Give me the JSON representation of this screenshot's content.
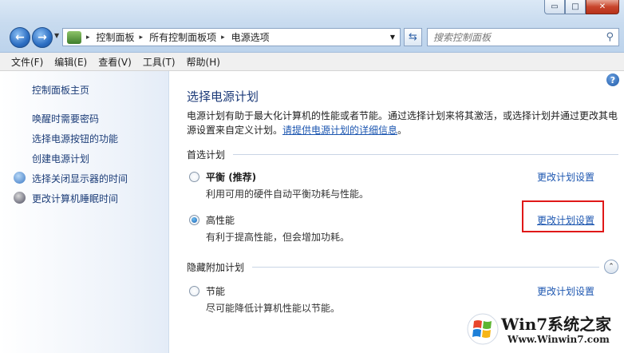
{
  "window": {
    "minimize_glyph": "▭",
    "maximize_glyph": "□",
    "close_glyph": "✕"
  },
  "nav": {
    "back_glyph": "←",
    "forward_glyph": "→"
  },
  "address": {
    "crumbs": [
      "控制面板",
      "所有控制面板项",
      "电源选项"
    ],
    "separator": "▸",
    "dropdown_glyph": "▼",
    "refresh_glyph": "⇆"
  },
  "search": {
    "placeholder": "搜索控制面板",
    "icon_glyph": "⚲"
  },
  "menu": {
    "items": [
      "文件(F)",
      "编辑(E)",
      "查看(V)",
      "工具(T)",
      "帮助(H)"
    ]
  },
  "sidebar": {
    "home": "控制面板主页",
    "links": [
      "唤醒时需要密码",
      "选择电源按钮的功能",
      "创建电源计划",
      "选择关闭显示器的时间",
      "更改计算机睡眠时间"
    ]
  },
  "main": {
    "help_glyph": "?",
    "title": "选择电源计划",
    "desc_text": "电源计划有助于最大化计算机的性能或者节能。通过选择计划来将其激活，或选择计划并通过更改其电源设置来自定义计划。",
    "desc_link": "请提供电源计划的详细信息",
    "desc_end": "。",
    "preferred_label": "首选计划",
    "hidden_label": "隐藏附加计划",
    "chevron_glyph": "⌃",
    "plans": [
      {
        "name_main": "平衡",
        "name_extra": " (推荐)",
        "desc": "利用可用的硬件自动平衡功耗与性能。",
        "link": "更改计划设置",
        "selected": false
      },
      {
        "name_main": "高性能",
        "name_extra": "",
        "desc": "有利于提高性能，但会增加功耗。",
        "link": "更改计划设置",
        "selected": true
      },
      {
        "name_main": "节能",
        "name_extra": "",
        "desc": "尽可能降低计算机性能以节能。",
        "link": "更改计划设置",
        "selected": false
      }
    ]
  },
  "watermark": {
    "title": "Win7系统之家",
    "url": "Www.Winwin7.com"
  },
  "colors": {
    "link": "#1c56b0",
    "highlight": "#e01818",
    "title": "#1c3a78"
  }
}
